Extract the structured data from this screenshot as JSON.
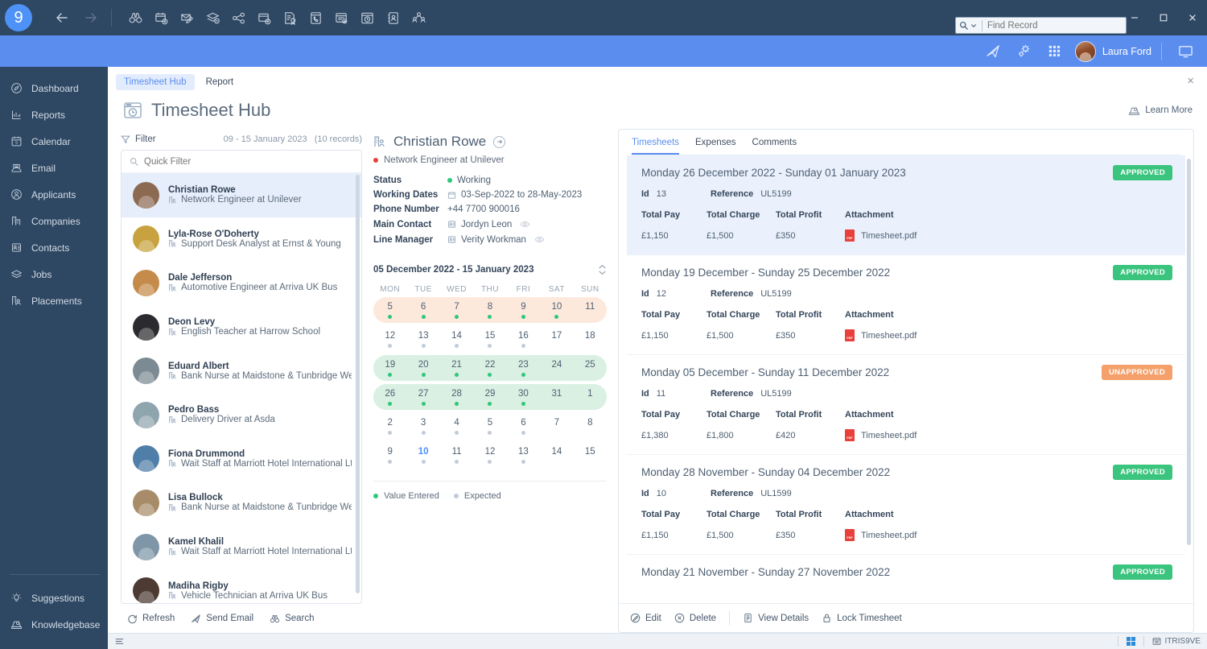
{
  "titlebar": {
    "logo_text": "9",
    "icons": [
      {
        "name": "back-icon"
      },
      {
        "name": "forward-icon"
      }
    ],
    "tools": [
      {
        "name": "binoculars-search-icon"
      },
      {
        "name": "add-calendar-icon"
      },
      {
        "name": "compose-email-icon"
      },
      {
        "name": "remove-stack-icon"
      },
      {
        "name": "share-network-icon"
      },
      {
        "name": "add-window-icon"
      },
      {
        "name": "certificate-document-icon"
      },
      {
        "name": "call-screen-icon"
      },
      {
        "name": "add-note-icon"
      },
      {
        "name": "timesheet-hub-icon"
      },
      {
        "name": "contact-book-icon"
      },
      {
        "name": "group-meeting-icon"
      }
    ],
    "search": {
      "placeholder": "Find Record",
      "value": ""
    },
    "window_buttons": [
      "minimize",
      "maximize",
      "close"
    ]
  },
  "bluebar": {
    "icons": [
      {
        "name": "paper-plane-icon"
      },
      {
        "name": "settings-gears-icon"
      },
      {
        "name": "apps-grid-icon"
      }
    ],
    "user_name": "Laura Ford",
    "screen_icon": "display-icon"
  },
  "sidebar": {
    "items": [
      {
        "label": "Dashboard",
        "icon": "dashboard-icon"
      },
      {
        "label": "Reports",
        "icon": "reports-chart-icon"
      },
      {
        "label": "Calendar",
        "icon": "calendar-icon"
      },
      {
        "label": "Email",
        "icon": "email-icon"
      },
      {
        "label": "Applicants",
        "icon": "applicants-person-icon"
      },
      {
        "label": "Companies",
        "icon": "companies-building-icon"
      },
      {
        "label": "Contacts",
        "icon": "contacts-card-icon"
      },
      {
        "label": "Jobs",
        "icon": "jobs-stack-icon"
      },
      {
        "label": "Placements",
        "icon": "placements-icon"
      }
    ],
    "bottom_items": [
      {
        "label": "Suggestions",
        "icon": "lightbulb-icon"
      },
      {
        "label": "Knowledgebase",
        "icon": "knowledgebase-icon"
      }
    ]
  },
  "content": {
    "tabs": [
      {
        "label": "Timesheet Hub",
        "active": true
      },
      {
        "label": "Report",
        "active": false
      }
    ],
    "close_label": "×",
    "page_title": "Timesheet Hub",
    "learn_more": "Learn More"
  },
  "list": {
    "filter_label": "Filter",
    "date_range": "09 - 15 January 2023",
    "record_count": "(10 records)",
    "quick_filter_placeholder": "Quick Filter",
    "rows": [
      {
        "name": "Christian Rowe",
        "job": "Network Engineer at Unilever",
        "selected": true,
        "avatar": "#8c6a52"
      },
      {
        "name": "Lyla-Rose O'Doherty",
        "job": "Support Desk Analyst at Ernst & Young",
        "selected": false,
        "avatar": "#c8a23f"
      },
      {
        "name": "Dale Jefferson",
        "job": "Automotive Engineer at Arriva UK Bus",
        "selected": false,
        "avatar": "#c58b4a"
      },
      {
        "name": "Deon Levy",
        "job": "English Teacher at Harrow School",
        "selected": false,
        "avatar": "#2b2b2f"
      },
      {
        "name": "Eduard Albert",
        "job": "Bank Nurse at Maidstone & Tunbridge Well...",
        "selected": false,
        "avatar": "#7b8a93"
      },
      {
        "name": "Pedro Bass",
        "job": "Delivery Driver at Asda",
        "selected": false,
        "avatar": "#8fa5ae"
      },
      {
        "name": "Fiona Drummond",
        "job": "Wait Staff at Marriott Hotel International Ltd",
        "selected": false,
        "avatar": "#4f7fa8"
      },
      {
        "name": "Lisa Bullock",
        "job": "Bank Nurse at Maidstone & Tunbridge Well...",
        "selected": false,
        "avatar": "#a88c6a"
      },
      {
        "name": "Kamel Khalil",
        "job": "Wait Staff at Marriott Hotel International Ltd",
        "selected": false,
        "avatar": "#7e96a8"
      },
      {
        "name": "Madiha Rigby",
        "job": "Vehicle Technician at Arriva UK Bus",
        "selected": false,
        "avatar": "#4c3a33"
      }
    ],
    "footer_actions": [
      {
        "label": "Refresh",
        "icon": "refresh-icon"
      },
      {
        "label": "Send Email",
        "icon": "send-email-icon"
      },
      {
        "label": "Search",
        "icon": "binoculars-search-icon"
      }
    ]
  },
  "detail": {
    "name": "Christian Rowe",
    "subtitle": "Network Engineer at Unilever",
    "subtitle_dot_color": "#e8403a",
    "fields": [
      {
        "label": "Status",
        "value": "Working",
        "icon": "status-dot",
        "dot_color": "#2ec87a"
      },
      {
        "label": "Working Dates",
        "value": "03-Sep-2022 to 28-May-2023",
        "icon": "calendar-small-icon"
      },
      {
        "label": "Phone Number",
        "value": "+44 7700 900016",
        "icon": ""
      },
      {
        "label": "Main Contact",
        "value": "Jordyn Leon",
        "icon": "contact-card-icon",
        "eye": true
      },
      {
        "label": "Line Manager",
        "value": "Verity Workman",
        "icon": "contact-card-icon",
        "eye": true
      }
    ],
    "calendar": {
      "range_label": "05 December 2022 - 15 January 2023",
      "day_names": [
        "MON",
        "TUE",
        "WED",
        "THU",
        "FRI",
        "SAT",
        "SUN"
      ],
      "weeks": [
        {
          "highlight": "orange",
          "days": [
            {
              "n": "5",
              "dot": "green"
            },
            {
              "n": "6",
              "dot": "green"
            },
            {
              "n": "7",
              "dot": "green"
            },
            {
              "n": "8",
              "dot": "green"
            },
            {
              "n": "9",
              "dot": "green"
            },
            {
              "n": "10",
              "dot": "green"
            },
            {
              "n": "11",
              "dot": "none"
            }
          ]
        },
        {
          "highlight": "none",
          "days": [
            {
              "n": "12",
              "dot": "grey"
            },
            {
              "n": "13",
              "dot": "grey"
            },
            {
              "n": "14",
              "dot": "grey"
            },
            {
              "n": "15",
              "dot": "grey"
            },
            {
              "n": "16",
              "dot": "grey"
            },
            {
              "n": "17",
              "dot": "none"
            },
            {
              "n": "18",
              "dot": "none"
            }
          ]
        },
        {
          "highlight": "green",
          "days": [
            {
              "n": "19",
              "dot": "green"
            },
            {
              "n": "20",
              "dot": "green"
            },
            {
              "n": "21",
              "dot": "green"
            },
            {
              "n": "22",
              "dot": "green"
            },
            {
              "n": "23",
              "dot": "green"
            },
            {
              "n": "24",
              "dot": "none"
            },
            {
              "n": "25",
              "dot": "none"
            }
          ]
        },
        {
          "highlight": "green",
          "days": [
            {
              "n": "26",
              "dot": "green"
            },
            {
              "n": "27",
              "dot": "green"
            },
            {
              "n": "28",
              "dot": "green"
            },
            {
              "n": "29",
              "dot": "green"
            },
            {
              "n": "30",
              "dot": "green"
            },
            {
              "n": "31",
              "dot": "none"
            },
            {
              "n": "1",
              "dot": "none"
            }
          ]
        },
        {
          "highlight": "none",
          "days": [
            {
              "n": "2",
              "dot": "grey"
            },
            {
              "n": "3",
              "dot": "grey"
            },
            {
              "n": "4",
              "dot": "grey"
            },
            {
              "n": "5",
              "dot": "grey"
            },
            {
              "n": "6",
              "dot": "grey"
            },
            {
              "n": "7",
              "dot": "none"
            },
            {
              "n": "8",
              "dot": "none"
            }
          ]
        },
        {
          "highlight": "none",
          "days": [
            {
              "n": "9",
              "dot": "grey"
            },
            {
              "n": "10",
              "dot": "grey",
              "today": true
            },
            {
              "n": "11",
              "dot": "grey"
            },
            {
              "n": "12",
              "dot": "grey"
            },
            {
              "n": "13",
              "dot": "grey"
            },
            {
              "n": "14",
              "dot": "none"
            },
            {
              "n": "15",
              "dot": "none"
            }
          ]
        }
      ],
      "legend": [
        {
          "label": "Value Entered",
          "color": "#2ec87a"
        },
        {
          "label": "Expected",
          "color": "#c2ccd7"
        }
      ]
    }
  },
  "timesheets": {
    "tabs": [
      {
        "label": "Timesheets",
        "active": true
      },
      {
        "label": "Expenses",
        "active": false
      },
      {
        "label": "Comments",
        "active": false
      }
    ],
    "column_headers": [
      "Total Pay",
      "Total Charge",
      "Total Profit",
      "Attachment"
    ],
    "id_label": "Id",
    "reference_label": "Reference",
    "cards": [
      {
        "title": "Monday 26 December 2022 - Sunday 01 January 2023",
        "status": "APPROVED",
        "status_color": "#3ac47d",
        "selected": true,
        "id": "13",
        "reference": "UL5199",
        "total_pay": "£1,150",
        "total_charge": "£1,500",
        "total_profit": "£350",
        "attachment": "Timesheet.pdf"
      },
      {
        "title": "Monday 19 December - Sunday 25 December 2022",
        "status": "APPROVED",
        "status_color": "#3ac47d",
        "selected": false,
        "id": "12",
        "reference": "UL5199",
        "total_pay": "£1,150",
        "total_charge": "£1,500",
        "total_profit": "£350",
        "attachment": "Timesheet.pdf"
      },
      {
        "title": "Monday 05 December - Sunday 11 December 2022",
        "status": "UNAPPROVED",
        "status_color": "#f5a06a",
        "selected": false,
        "id": "11",
        "reference": "UL5199",
        "total_pay": "£1,380",
        "total_charge": "£1,800",
        "total_profit": "£420",
        "attachment": "Timesheet.pdf"
      },
      {
        "title": "Monday 28 November - Sunday 04 December 2022",
        "status": "APPROVED",
        "status_color": "#3ac47d",
        "selected": false,
        "id": "10",
        "reference": "UL1599",
        "total_pay": "£1,150",
        "total_charge": "£1,500",
        "total_profit": "£350",
        "attachment": "Timesheet.pdf"
      },
      {
        "title": "Monday 21 November - Sunday 27 November 2022",
        "status": "APPROVED",
        "status_color": "#3ac47d",
        "selected": false,
        "id": "",
        "reference": "",
        "total_pay": "",
        "total_charge": "",
        "total_profit": "",
        "attachment": ""
      }
    ],
    "actions": [
      {
        "label": "Edit",
        "icon": "edit-pencil-icon"
      },
      {
        "label": "Delete",
        "icon": "delete-circle-icon"
      },
      {
        "label": "View Details",
        "icon": "view-details-icon"
      },
      {
        "label": "Lock Timesheet",
        "icon": "lock-icon"
      }
    ]
  },
  "statusbar": {
    "menu_icon": "hamburger-icon",
    "app_label": "ITRIS9VE"
  }
}
